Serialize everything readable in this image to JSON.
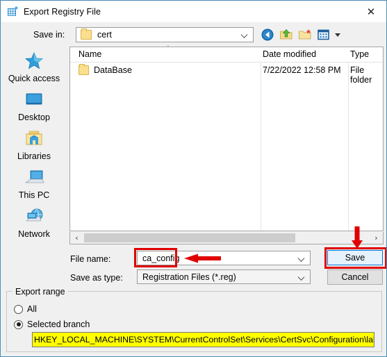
{
  "window": {
    "title": "Export Registry File",
    "icon": "registry-editor-icon",
    "close_label": "✕"
  },
  "savein": {
    "label": "Save in:",
    "value": "cert",
    "icon": "folder-icon"
  },
  "toolbar": {
    "items": [
      {
        "name": "back-navigation-icon",
        "tooltip": "Back"
      },
      {
        "name": "up-one-level-icon",
        "tooltip": "Up One Level"
      },
      {
        "name": "create-new-folder-icon",
        "tooltip": "Create New Folder"
      },
      {
        "name": "views-icon",
        "tooltip": "Views"
      }
    ],
    "caret": "views-dropdown-caret"
  },
  "places": [
    {
      "label": "Quick access",
      "icon": "quick-access-star-icon"
    },
    {
      "label": "Desktop",
      "icon": "desktop-monitor-icon"
    },
    {
      "label": "Libraries",
      "icon": "libraries-folder-icon"
    },
    {
      "label": "This PC",
      "icon": "this-pc-laptop-icon"
    },
    {
      "label": "Network",
      "icon": "network-globe-icon"
    }
  ],
  "filelist": {
    "columns": [
      "Name",
      "Date modified",
      "Type"
    ],
    "sort_indicator": "˄",
    "rows": [
      {
        "name": "DataBase",
        "date_modified": "7/22/2022 12:58 PM",
        "type": "File folder",
        "icon": "folder-icon"
      }
    ]
  },
  "scrollbar": {
    "left_arrow": "‹",
    "right_arrow": "›"
  },
  "filename": {
    "label": "File name:",
    "value": "ca_config",
    "placeholder": ""
  },
  "savetype": {
    "label": "Save as type:",
    "value": "Registration Files (*.reg)"
  },
  "buttons": {
    "save": "Save",
    "cancel": "Cancel"
  },
  "export_range": {
    "group_title": "Export range",
    "options": [
      {
        "label": "All",
        "selected": false
      },
      {
        "label": "Selected branch",
        "selected": true
      }
    ],
    "branch_path": "HKEY_LOCAL_MACHINE\\SYSTEM\\CurrentControlSet\\Services\\CertSvc\\Configuration\\lab-ca"
  },
  "annotations": {
    "highlight_color": "#e00000",
    "path_highlight_color": "#ffff00",
    "boxes": [
      "filename-field",
      "save-button"
    ],
    "arrows": [
      "arrow-to-filename",
      "arrow-to-save-button"
    ]
  }
}
